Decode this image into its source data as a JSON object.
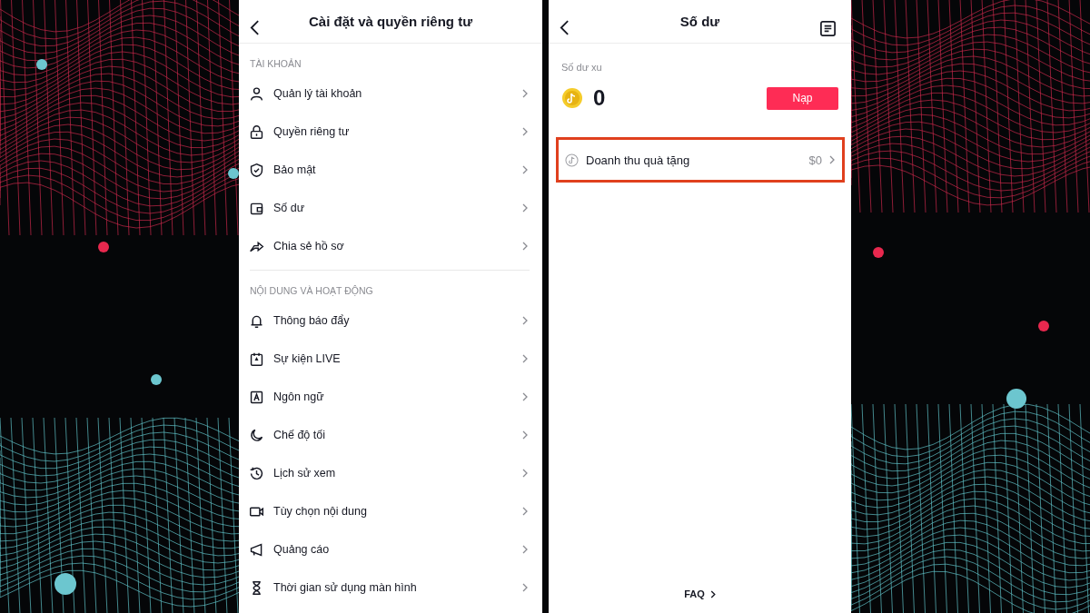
{
  "settings_screen": {
    "title": "Cài đặt và quyền riêng tư",
    "sections": [
      {
        "heading": "TÀI KHOẢN",
        "items": [
          {
            "label": "Quản lý tài khoản"
          },
          {
            "label": "Quyền riêng tư"
          },
          {
            "label": "Bảo mật"
          },
          {
            "label": "Số dư"
          },
          {
            "label": "Chia sẻ hồ sơ"
          }
        ]
      },
      {
        "heading": "NỘI DUNG VÀ HOẠT ĐỘNG",
        "items": [
          {
            "label": "Thông báo đẩy"
          },
          {
            "label": "Sự kiện LIVE"
          },
          {
            "label": "Ngôn ngữ"
          },
          {
            "label": "Chế độ tối"
          },
          {
            "label": "Lịch sử xem"
          },
          {
            "label": "Tùy chọn nội dung"
          },
          {
            "label": "Quảng cáo"
          },
          {
            "label": "Thời gian sử dụng màn hình"
          }
        ]
      }
    ]
  },
  "balance_screen": {
    "title": "Số dư",
    "coin_label": "Số dư xu",
    "coin_amount": "0",
    "recharge_button": "Nạp",
    "rows": [
      {
        "label": "Doanh thu quà tặng",
        "value": "$0",
        "highlighted": true
      }
    ],
    "faq_link": "FAQ"
  }
}
